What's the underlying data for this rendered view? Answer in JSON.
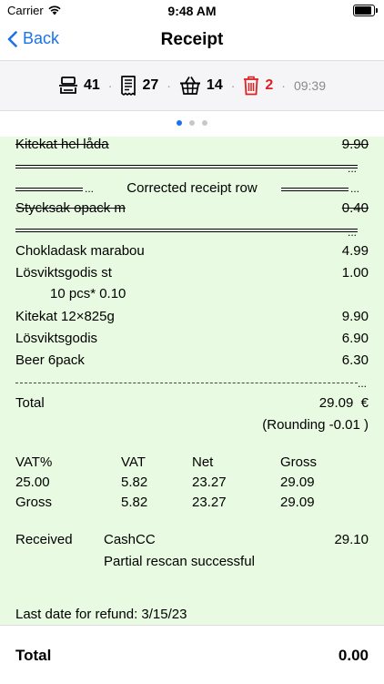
{
  "status_bar": {
    "carrier": "Carrier",
    "time": "9:48 AM",
    "battery_level": 0.9
  },
  "nav": {
    "back_label": "Back",
    "title": "Receipt"
  },
  "toolbar": {
    "scanner_count": "41",
    "receipts_count": "27",
    "basket_count": "14",
    "deleted_count": "2",
    "time": "09:39",
    "separator": "·"
  },
  "pager": {
    "pages": 3,
    "active": 0
  },
  "receipt": {
    "voided_item1": {
      "name": "Kitekat hel låda",
      "price": "9.90"
    },
    "corrected_label": "Corrected receipt row",
    "voided_item2": {
      "name": "Stycksak opack m",
      "price": "0.40"
    },
    "items": [
      {
        "name": "Chokladask marabou",
        "price": "4.99"
      },
      {
        "name": "Lösviktsgodis st",
        "price": "1.00"
      },
      {
        "name": "10 pcs* 0.10",
        "price": ""
      },
      {
        "name": "Kitekat 12×825g",
        "price": "9.90"
      },
      {
        "name": "Lösviktsgodis",
        "price": "6.90"
      },
      {
        "name": "Beer 6pack",
        "price": "6.30"
      }
    ],
    "total_label": "Total",
    "total_value": "29.09  €",
    "rounding": "(Rounding -0.01 )",
    "vat_headers": [
      "VAT%",
      "VAT",
      "Net",
      "Gross"
    ],
    "vat_rows": [
      [
        "25.00",
        "5.82",
        "23.27",
        "29.09"
      ],
      [
        "Gross",
        "5.82",
        "23.27",
        "29.09"
      ]
    ],
    "received_label": "Received",
    "received_method": "CashCC",
    "received_amount": "29.10",
    "rescan_message": "Partial rescan successful",
    "refund_text": "Last date for refund: 3/15/23"
  },
  "footer": {
    "total_label": "Total",
    "total_value": "0.00"
  },
  "colors": {
    "accent": "#1a73e8",
    "delete": "#e02020",
    "receipt_bg": "#e8fae1"
  }
}
